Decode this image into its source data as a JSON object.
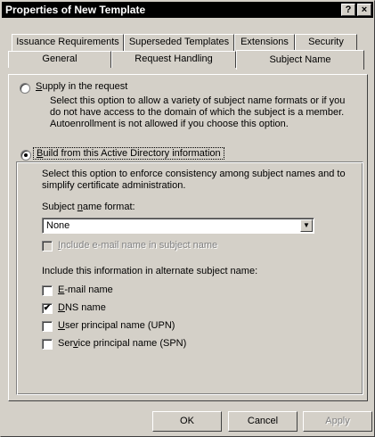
{
  "window": {
    "title": "Properties of New Template",
    "help_glyph": "?",
    "close_glyph": "×"
  },
  "tabs_row1": [
    {
      "label": "Issuance Requirements"
    },
    {
      "label": "Superseded Templates"
    },
    {
      "label": "Extensions"
    },
    {
      "label": "Security"
    }
  ],
  "tabs_row2": [
    {
      "label": "General"
    },
    {
      "label": "Request Handling"
    },
    {
      "label": "Subject Name",
      "active": true
    }
  ],
  "supply": {
    "label_accel": "S",
    "label_rest": "upply in the request",
    "selected": false,
    "description": "Select this option to allow a variety of subject name formats or if you do not have access to the domain of which the subject is a member. Autoenrollment is not allowed if you choose this option."
  },
  "build": {
    "label_accel": "B",
    "label_rest": "uild from this Active Directory information",
    "selected": true,
    "description": "Select this option to enforce consistency among subject names and to simplify certificate administration.",
    "format_label_pre": "Subject ",
    "format_label_accel": "n",
    "format_label_post": "ame format:",
    "format_value": "None",
    "include_email": {
      "accel": "I",
      "rest": "nclude e-mail name in subject name",
      "checked": false,
      "disabled": true
    },
    "alt_heading": "Include this information in alternate subject name:",
    "alt_options": [
      {
        "pre": "",
        "accel": "E",
        "post": "-mail name",
        "checked": false
      },
      {
        "pre": "",
        "accel": "D",
        "post": "NS name",
        "checked": true
      },
      {
        "pre": "",
        "accel": "U",
        "post": "ser principal name (UPN)",
        "checked": false
      },
      {
        "pre": "Ser",
        "accel": "v",
        "post": "ice principal name (SPN)",
        "checked": false
      }
    ]
  },
  "buttons": {
    "ok": "OK",
    "cancel": "Cancel",
    "apply": "Apply"
  },
  "glyphs": {
    "check": "✔",
    "dropdown_arrow": "▼"
  }
}
